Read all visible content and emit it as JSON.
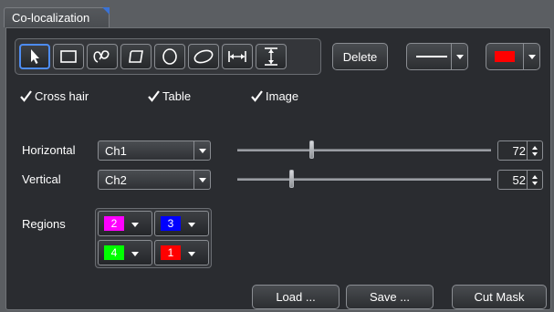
{
  "tab": {
    "title": "Co-localization"
  },
  "toolbar": {
    "tools": [
      {
        "name": "select-arrow-icon"
      },
      {
        "name": "rectangle-icon"
      },
      {
        "name": "freehand-loop-icon"
      },
      {
        "name": "rounded-rectangle-icon"
      },
      {
        "name": "ellipse-icon"
      },
      {
        "name": "oval-icon"
      },
      {
        "name": "horizontal-distance-icon"
      },
      {
        "name": "vertical-distance-icon"
      }
    ],
    "active_tool": "select-arrow-icon",
    "delete_label": "Delete",
    "line_style": "solid",
    "color_value": "#ff0000"
  },
  "options": {
    "cross_hair": {
      "label": "Cross hair",
      "checked": true
    },
    "table": {
      "label": "Table",
      "checked": true
    },
    "image": {
      "label": "Image",
      "checked": true
    }
  },
  "horizontal": {
    "label": "Horizontal",
    "channel": "Ch1",
    "value": "72"
  },
  "vertical": {
    "label": "Vertical",
    "channel": "Ch2",
    "value": "52"
  },
  "regions": {
    "label": "Regions",
    "items": [
      {
        "number": "2",
        "color": "#ff00ff"
      },
      {
        "number": "3",
        "color": "#0000ff"
      },
      {
        "number": "4",
        "color": "#00ff00"
      },
      {
        "number": "1",
        "color": "#ff0000"
      }
    ]
  },
  "buttons": {
    "load": "Load ...",
    "save": "Save ...",
    "cut_mask": "Cut Mask"
  },
  "colors": {
    "accent": "#4d8cf2",
    "background": "#2a2c30",
    "frame": "#5b5e62"
  }
}
